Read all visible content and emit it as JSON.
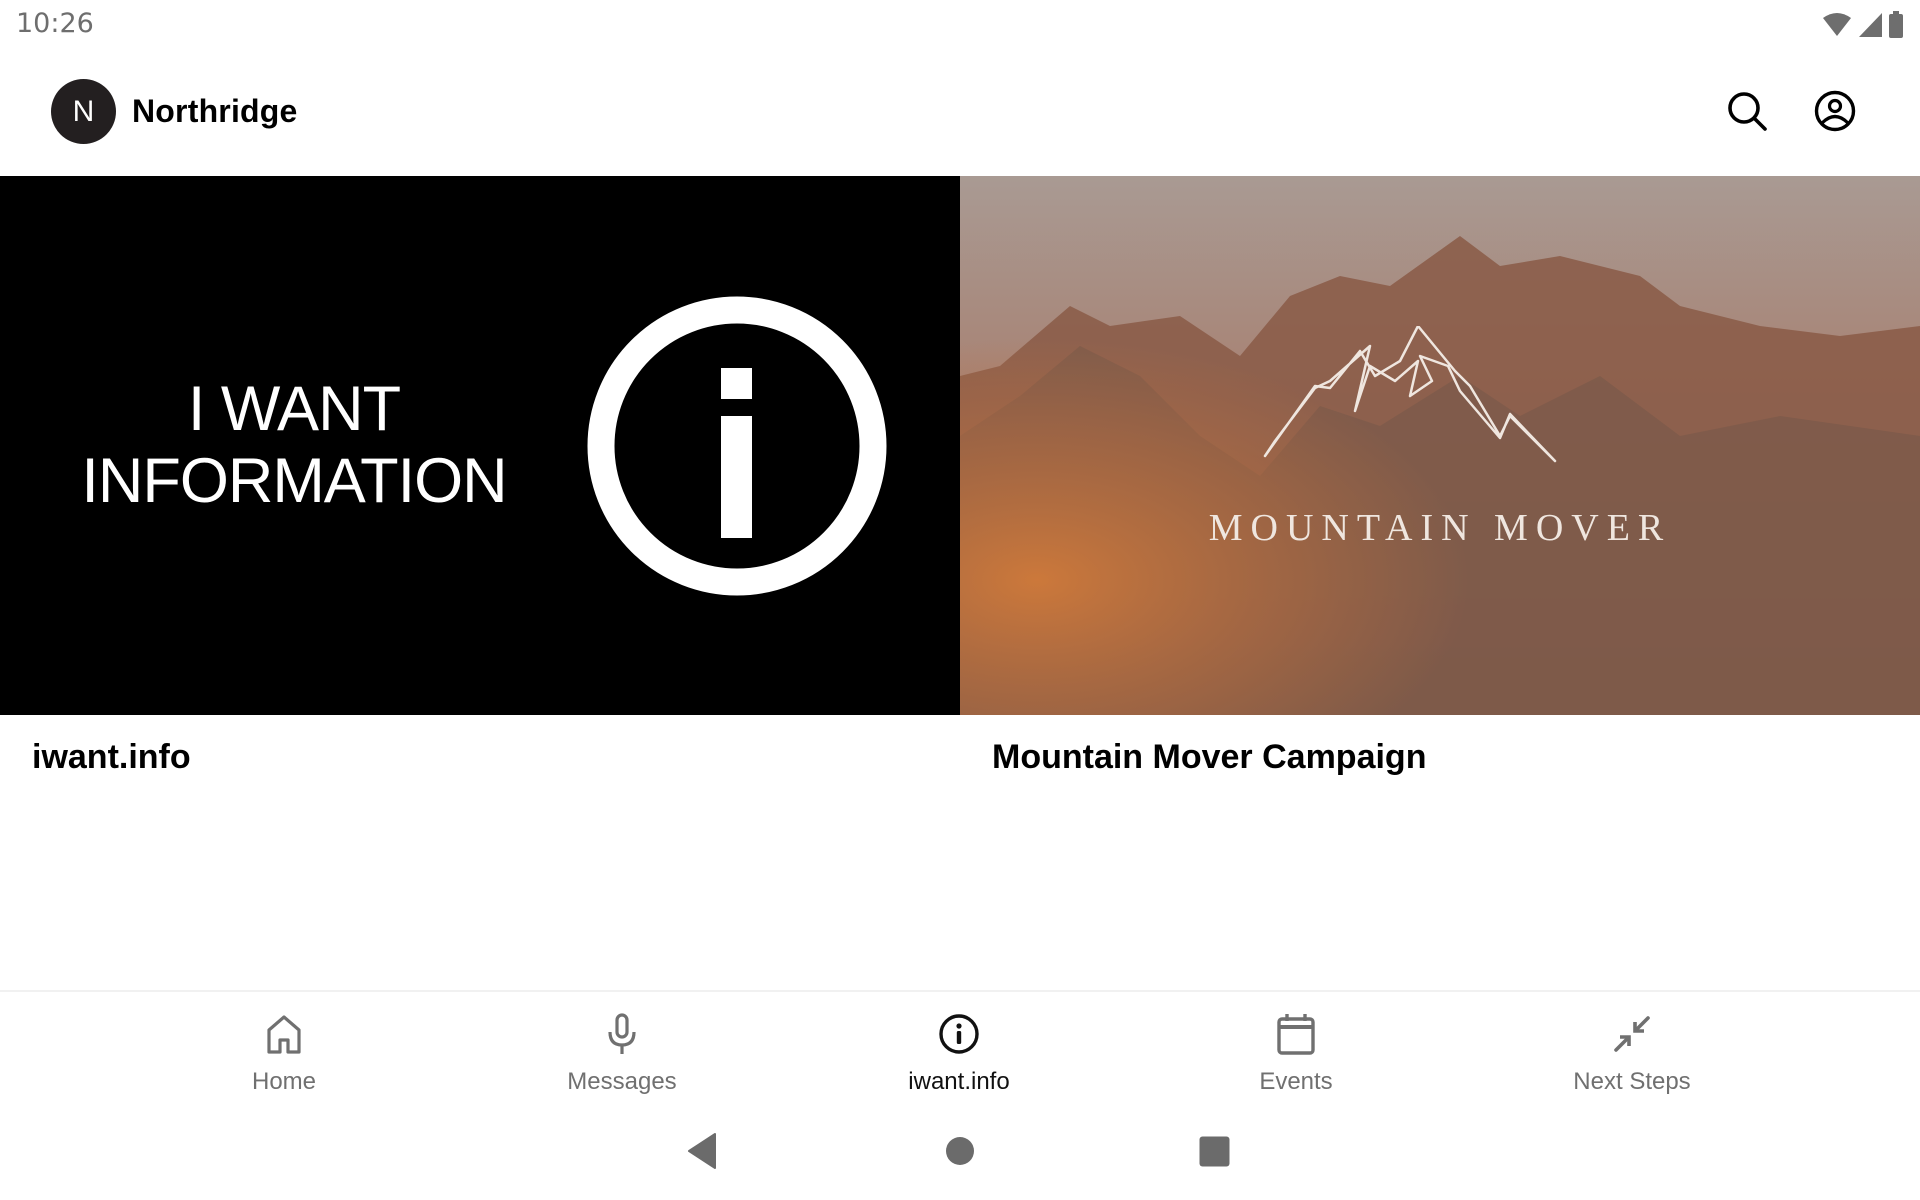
{
  "status_bar": {
    "time": "10:26",
    "icons": [
      "wifi-icon",
      "cellular-signal-icon",
      "battery-icon"
    ]
  },
  "header": {
    "logo_letter": "N",
    "title": "Northridge",
    "actions": [
      {
        "name": "search",
        "icon": "search-icon"
      },
      {
        "name": "account",
        "icon": "account-circle-icon"
      }
    ]
  },
  "cards": [
    {
      "banner_line1": "I WANT",
      "banner_line2": "INFORMATION",
      "banner_icon": "info-icon",
      "caption": "iwant.info"
    },
    {
      "banner_text": "MOUNTAIN MOVER",
      "banner_icon": "mountain-logo-icon",
      "caption": "Mountain Mover Campaign"
    }
  ],
  "bottom_nav": {
    "active_index": 2,
    "items": [
      {
        "label": "Home",
        "icon": "home-icon"
      },
      {
        "label": "Messages",
        "icon": "microphone-icon"
      },
      {
        "label": "iwant.info",
        "icon": "info-icon"
      },
      {
        "label": "Events",
        "icon": "calendar-icon"
      },
      {
        "label": "Next Steps",
        "icon": "collapse-arrows-icon"
      }
    ]
  },
  "system_nav": [
    "back",
    "home",
    "recents"
  ],
  "colors": {
    "inactive_nav": "#707070",
    "active_nav": "#111111",
    "logo_bg": "#231f20",
    "system_icons": "#6b6b6b"
  }
}
